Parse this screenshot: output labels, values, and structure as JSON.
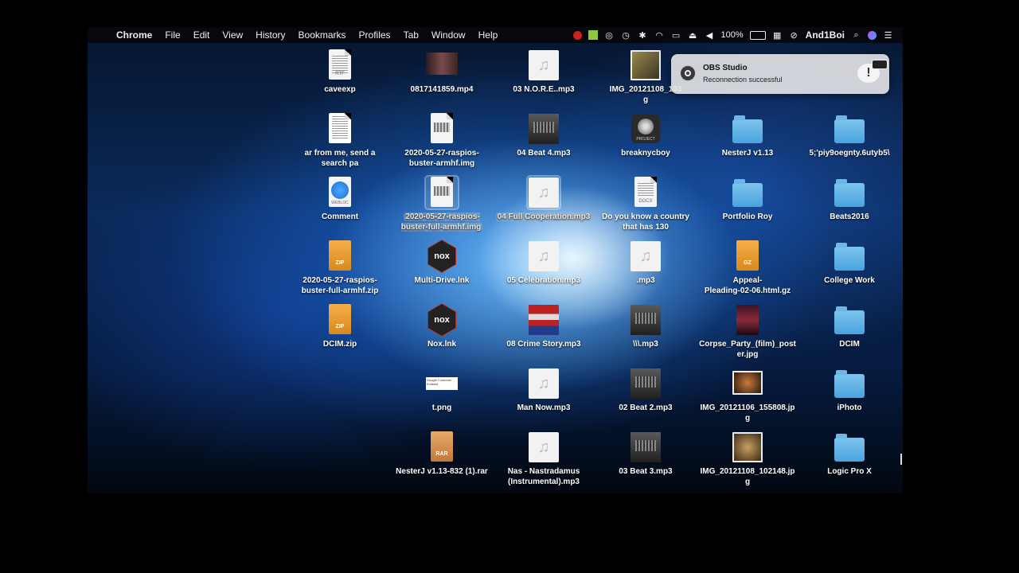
{
  "menubar": {
    "apple_glyph": "",
    "app_name": "Chrome",
    "items": [
      "File",
      "Edit",
      "View",
      "History",
      "Bookmarks",
      "Profiles",
      "Tab",
      "Window",
      "Help"
    ],
    "battery": "100%",
    "user": "And1Boi"
  },
  "notification": {
    "app": "OBS Studio",
    "message": "Reconnection successful",
    "warn_glyph": "!"
  },
  "desktop": {
    "caveexp": "caveexp",
    "mp4": "0817141859.mp4",
    "nore": "03 N.O.R.E..mp3",
    "img1103": "IMG_20121108_103\ng",
    "arfrom": "ar from me, send a\nsearch pa",
    "raspios_armhf_img": "2020-05-27-raspios-\nbuster-armhf.img",
    "beat4": "04 Beat 4.mp3",
    "breaknycboy": "breaknycboy",
    "nesterj": "NesterJ v1.13",
    "piy9": "5;'piy9oegnty.6utyb5\\",
    "comment": "Comment",
    "raspios_full_img": "2020-05-27-raspios-\nbuster-full-armhf.img",
    "fullcoop": "04 Full Cooperation.mp3",
    "doyouknow": "Do you know a country\nthat has 130",
    "portfolio": "Portfolio Roy",
    "beats2016": "Beats2016",
    "raspios_zip": "2020-05-27-raspios-\nbuster-full-armhf.zip",
    "multidrive": "Multi-Drive.lnk",
    "celebration": "05 Celebration.mp3",
    "dotmp3": ".mp3",
    "appeal": "Appeal-\nPleading-02-06.html.gz",
    "college": "College Work",
    "dcimzip": "DCIM.zip",
    "nox": "Nox.lnk",
    "crimestory": "08 Crime Story.mp3",
    "backslash": "\\\\\\.mp3",
    "corpse": "Corpse_Party_(film)_post\ner.jpg",
    "dcim": "DCIM",
    "tpng": "t.png",
    "mannow": "Man Now.mp3",
    "beat2": "02 Beat 2.mp3",
    "img155808": "IMG_20121106_155808.jp\ng",
    "iphoto": "iPhoto",
    "rar": "NesterJ v1.13-832 (1).rar",
    "nas": "Nas - Nastradamus\n(Instrumental).mp3",
    "beat3": "03 Beat 3.mp3",
    "img102148": "IMG_20121108_102148.jp\ng",
    "logic": "Logic Pro X"
  },
  "file_tags": {
    "rtf": "RTF",
    "zip": "ZIP",
    "gz": "GZ",
    "rar": "RAR",
    "docx": "DOCX",
    "webloc": "WEBLOC",
    "project": "PROJECT",
    "png_text": "Google Customer Enlisted"
  },
  "icons": {
    "audio_glyph": "♫",
    "nox_logo": "nox"
  }
}
